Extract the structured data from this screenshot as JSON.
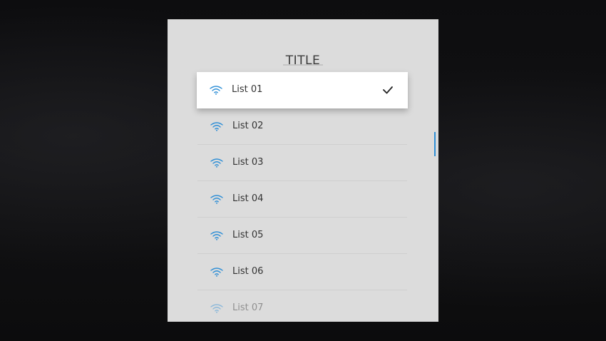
{
  "popup": {
    "title": "TITLE",
    "items": [
      {
        "label": "List 01",
        "icon": "wifi-icon",
        "selected": true
      },
      {
        "label": "List 02",
        "icon": "wifi-icon",
        "selected": false
      },
      {
        "label": "List 03",
        "icon": "wifi-icon",
        "selected": false
      },
      {
        "label": "List 04",
        "icon": "wifi-icon",
        "selected": false
      },
      {
        "label": "List 05",
        "icon": "wifi-icon",
        "selected": false
      },
      {
        "label": "List 06",
        "icon": "wifi-icon",
        "selected": false
      },
      {
        "label": "List 07",
        "icon": "wifi-icon",
        "selected": false
      }
    ]
  },
  "colors": {
    "accent": "#2f8fd6",
    "panel": "#dcdcdc",
    "selected_bg": "#ffffff"
  }
}
